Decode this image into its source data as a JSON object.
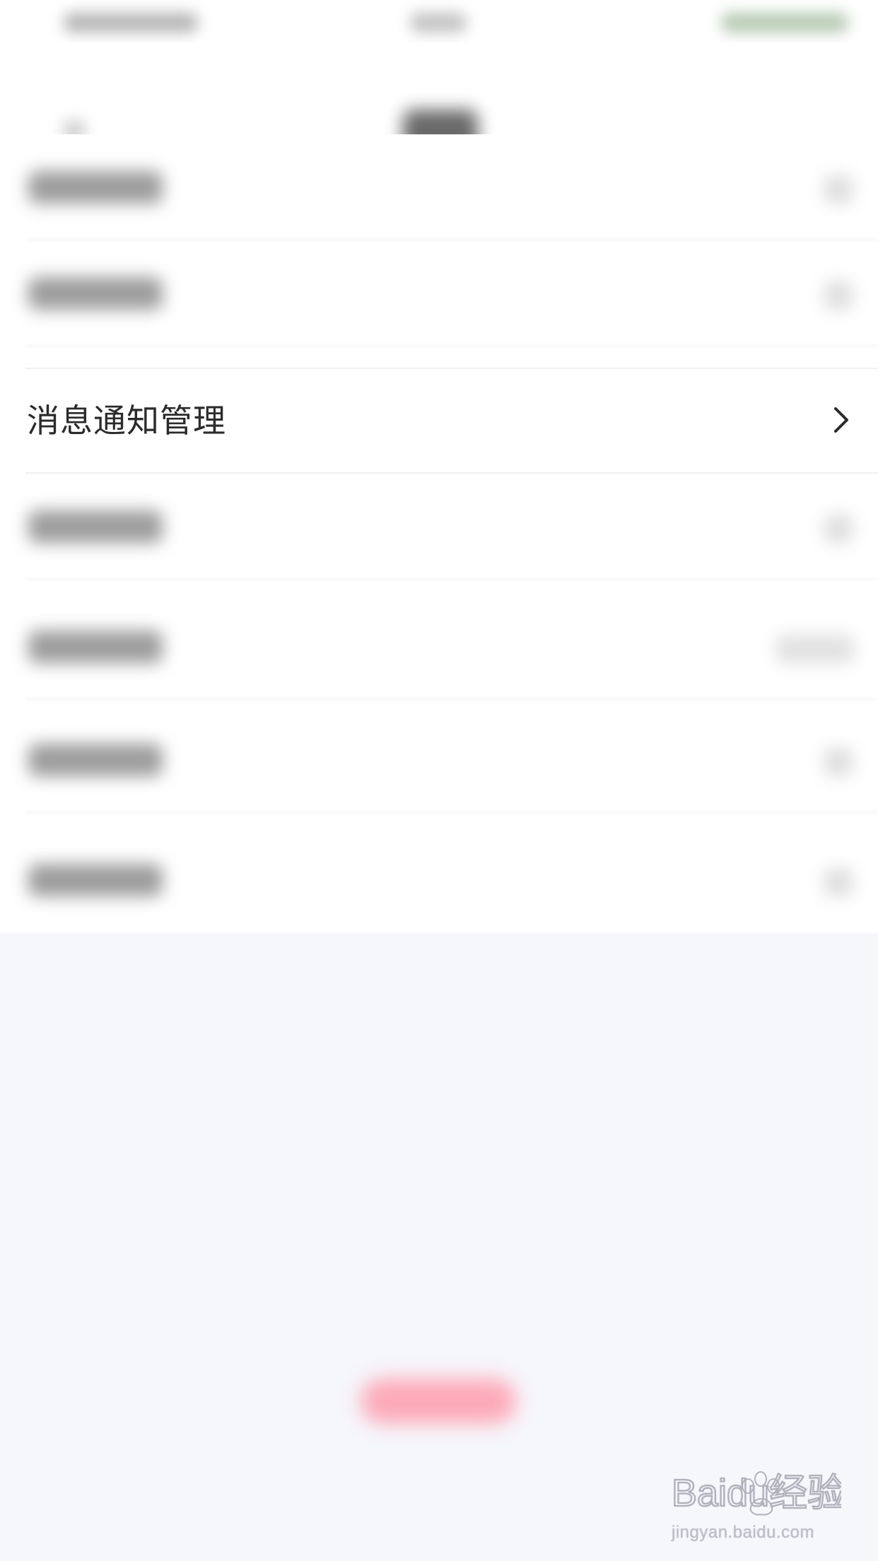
{
  "settings": {
    "focused_item_label": "消息通知管理"
  },
  "watermark": {
    "brand": "Baidu经验",
    "url": "jingyan.baidu.com"
  },
  "colors": {
    "background": "#f6f7fb",
    "surface": "#ffffff",
    "text_primary": "#2b2b2b",
    "divider": "#f0f0f4",
    "logout_accent": "#ff8fa3"
  },
  "icons": {
    "chevron": "chevron-right-icon",
    "watermark_logo": "baidu-paw-icon"
  }
}
